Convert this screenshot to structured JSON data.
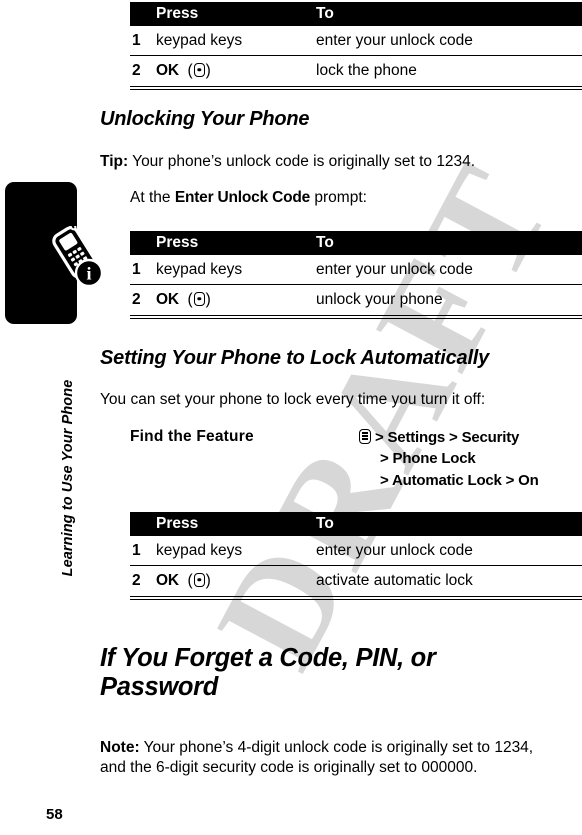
{
  "sidebar": {
    "chapter_label": "Learning to Use Your Phone",
    "page_number": "58",
    "tab_icon": "phone-info-icon"
  },
  "watermark": {
    "text": "DRAFT",
    "color": "#c8c8c8"
  },
  "tables": {
    "header": {
      "num": "",
      "press": "Press",
      "to": "To"
    },
    "lock_phone": {
      "rows": [
        {
          "num": "1",
          "press": "keypad keys",
          "press_glyph": "",
          "to": "enter your unlock code"
        },
        {
          "num": "2",
          "press": "OK",
          "press_glyph": "center-key-icon",
          "to": "lock the phone"
        }
      ]
    },
    "unlock_phone": {
      "rows": [
        {
          "num": "1",
          "press": "keypad keys",
          "press_glyph": "",
          "to": "enter your unlock code"
        },
        {
          "num": "2",
          "press": "OK",
          "press_glyph": "center-key-icon",
          "to": "unlock your phone"
        }
      ]
    },
    "automatic_lock": {
      "rows": [
        {
          "num": "1",
          "press": "keypad keys",
          "press_glyph": "",
          "to": "enter your unlock code"
        },
        {
          "num": "2",
          "press": "OK",
          "press_glyph": "center-key-icon",
          "to": "activate automatic lock"
        }
      ]
    }
  },
  "sections": {
    "unlocking": {
      "heading": "Unlocking Your Phone",
      "tip_label": "Tip:",
      "tip_text": " Your phone’s unlock code is originally set to 1234.",
      "prompt_pre": "At the ",
      "prompt_screen": "Enter Unlock Code",
      "prompt_post": " prompt:"
    },
    "auto_lock": {
      "heading": "Setting Your Phone to Lock Automatically",
      "intro": "You can set your phone to lock every time you turn it off:",
      "find_label": "Find the Feature",
      "path_line1": "> Settings > Security",
      "path_line2": "> Phone Lock",
      "path_line3": "> Automatic Lock > On",
      "path_icon": "menu-key-icon"
    },
    "forgot": {
      "heading": "If You Forget a Code, PIN, or Password",
      "note_label": "Note:",
      "note_text": " Your phone’s 4-digit unlock code is originally set to 1234, and the 6-digit security code is originally set to 000000."
    }
  }
}
